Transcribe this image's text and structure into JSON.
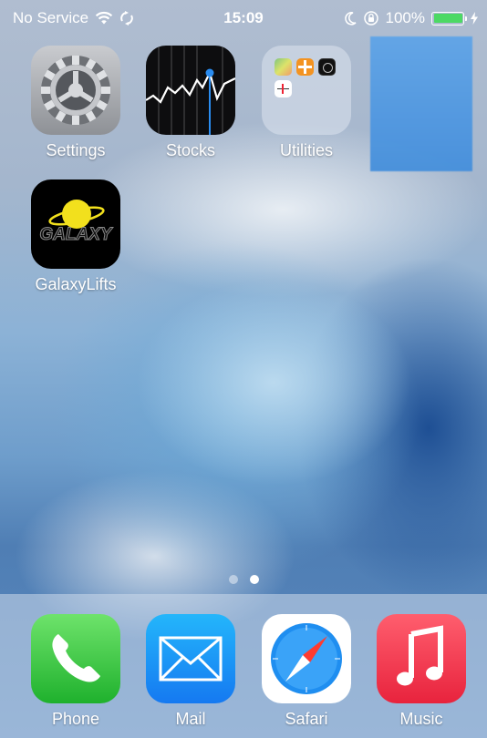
{
  "status_bar": {
    "carrier": "No Service",
    "time": "15:09",
    "battery_percent": "100%",
    "battery_level": 1.0,
    "battery_color": "#4cd964"
  },
  "home_apps": [
    {
      "label": "Settings",
      "icon": "gear-icon"
    },
    {
      "label": "Stocks",
      "icon": "stock-chart-icon"
    },
    {
      "label": "Utilities",
      "icon": "folder-icon"
    },
    {
      "label": "GalaxyLifts",
      "icon": "galaxy-logo-icon",
      "logo_text": "GALAXY"
    }
  ],
  "page_indicator": {
    "pages": 2,
    "current": 2
  },
  "dock_apps": [
    {
      "label": "Phone",
      "icon": "phone-icon"
    },
    {
      "label": "Mail",
      "icon": "envelope-icon"
    },
    {
      "label": "Safari",
      "icon": "compass-icon"
    },
    {
      "label": "Music",
      "icon": "music-note-icon"
    }
  ]
}
